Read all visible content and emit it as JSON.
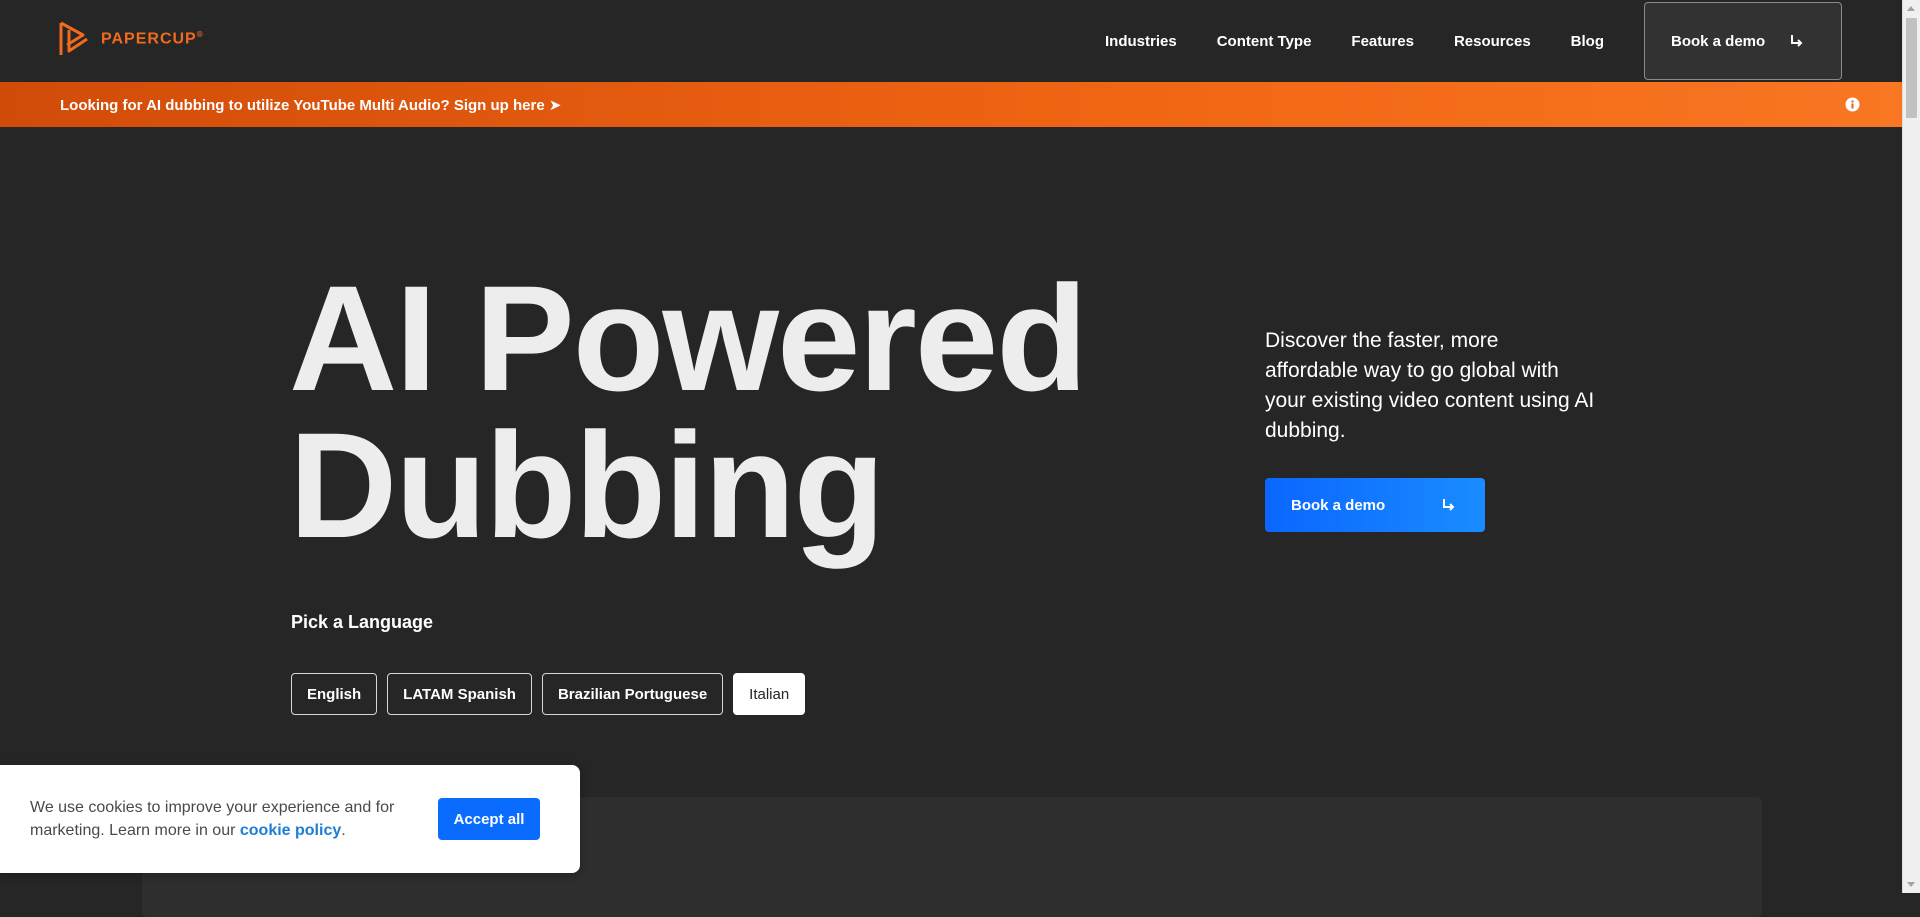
{
  "header": {
    "brand": "PAPERCUP",
    "brand_mark": "®",
    "nav": [
      "Industries",
      "Content Type",
      "Features",
      "Resources",
      "Blog"
    ],
    "demo_button": "Book a demo",
    "demo_icon": "arrow-down-right-icon"
  },
  "banner": {
    "lead": "Looking for AI dubbing to utilize ",
    "highlight": "YouTube Multi Audio",
    "tail": "? Sign up here ➤",
    "info_icon": "info-icon",
    "colors": [
      "#d14c09",
      "#f97623"
    ]
  },
  "hero": {
    "title_line1": "AI Powered",
    "title_line2": "Dubbing",
    "description": "Discover the faster, more affordable way to go global with your existing video content using AI dubbing.",
    "cta": "Book a demo",
    "cta_color": "#0a66ff",
    "pick_label": "Pick a Language",
    "languages": [
      "English",
      "LATAM Spanish",
      "Brazilian Portuguese",
      "Italian"
    ],
    "selected_language": "Italian"
  },
  "cookie": {
    "text": "We use cookies to improve your experience and for marketing. Learn more in our ",
    "link": "cookie policy",
    "tail": ".",
    "accept": "Accept all"
  }
}
